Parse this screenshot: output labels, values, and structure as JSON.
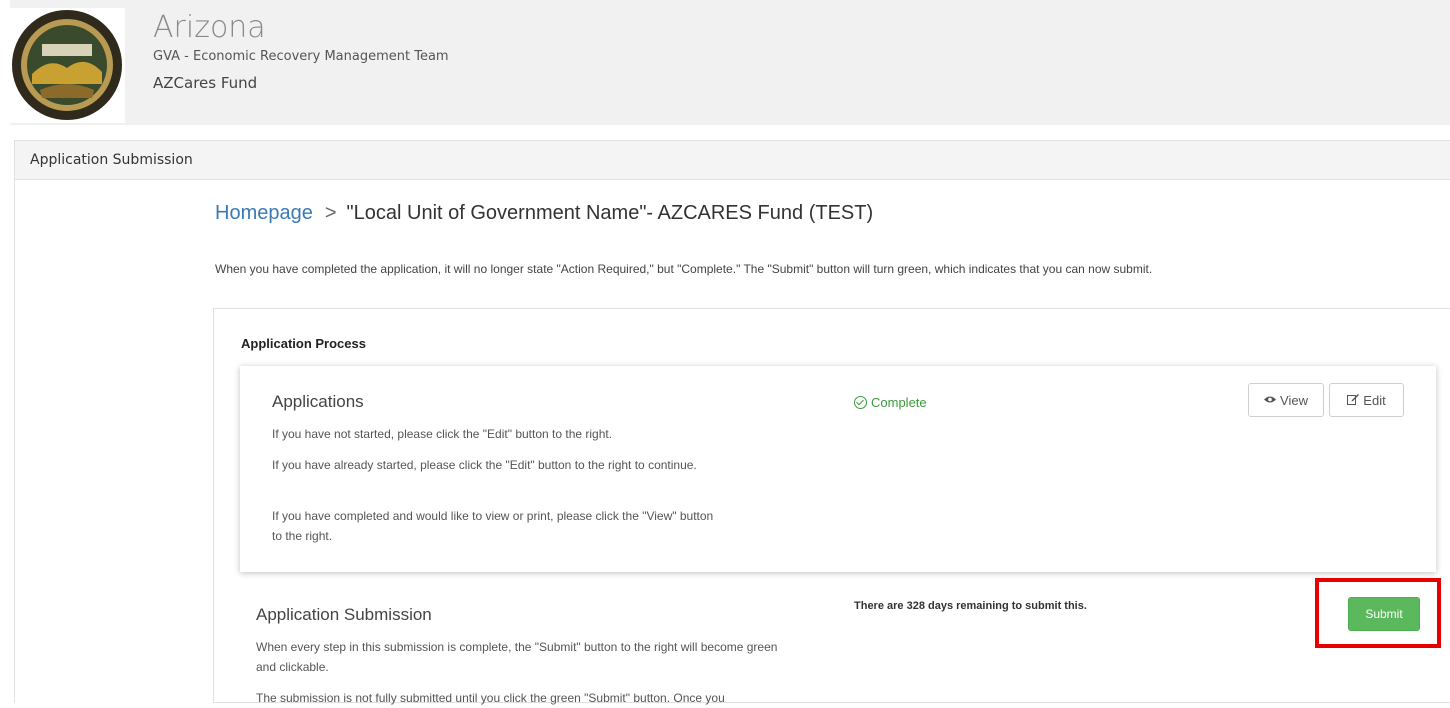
{
  "header": {
    "org_name": "Arizona",
    "subtitle": "GVA - Economic Recovery Management Team",
    "fund_name": "AZCares Fund"
  },
  "subbar": {
    "title": "Application Submission"
  },
  "breadcrumb": {
    "home": "Homepage",
    "separator": ">",
    "current": "\"Local Unit of Government Name\"- AZCARES Fund (TEST)"
  },
  "instructions": "When you have completed the application, it will no longer state \"Action Required,\" but \"Complete.\" The \"Submit\" button will turn green, which indicates that you can now submit.",
  "process": {
    "title": "Application Process",
    "applications": {
      "title": "Applications",
      "lines": [
        "If you have not started, please click the \"Edit\" button to the right.",
        "If you have already started, please click the \"Edit\" button to the right to continue.",
        "If you have completed and would like to view or print, please click the \"View\" button to the right."
      ],
      "status": "Complete",
      "view_label": "View",
      "edit_label": "Edit"
    },
    "submission": {
      "title": "Application Submission",
      "lines": [
        "When every step in this submission is complete, the \"Submit\" button to the right will become green and clickable.",
        "The submission is not fully submitted until you click the green \"Submit\" button. Once you"
      ],
      "days_remaining": "There are 328 days remaining to submit this.",
      "submit_label": "Submit"
    }
  },
  "colors": {
    "accent": "#3a7ab6",
    "success": "#5cb85c",
    "highlight": "#e60000"
  },
  "icons": {
    "status": "check-circle-icon",
    "view": "eye-icon",
    "edit": "edit-icon",
    "seal": "state-seal-icon"
  }
}
